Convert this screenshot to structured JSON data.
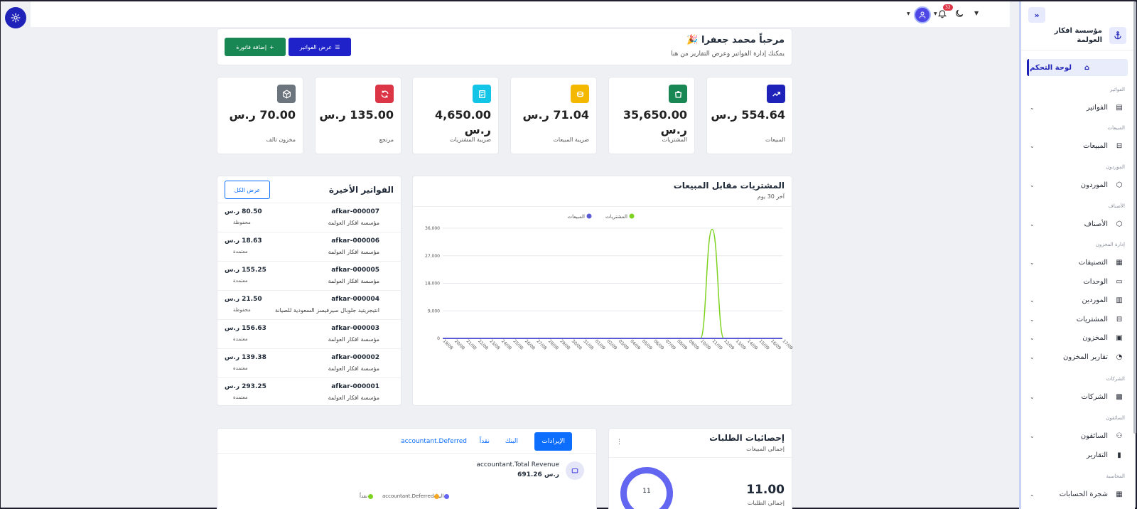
{
  "topbar": {
    "notif_count": "32"
  },
  "sidebar": {
    "org_name": "مؤسسة افكار العولمة",
    "dashboard": "لوحة التحكم",
    "sections": {
      "invoices": "الفواتير",
      "sales": "المبيعات",
      "suppliers": "الموردون",
      "items": "الأصناف",
      "inventory": "إدارة المخزون",
      "companies": "الشركات",
      "drivers": "السائقون",
      "accounting": "المحاسبة"
    },
    "items": {
      "invoices": "الفواتير",
      "sales": "المبيعات",
      "suppliers": "الموردون",
      "items": "الأصناف",
      "categories": "التصنيفات",
      "units": "الوحدات",
      "vendors": "الموردين",
      "purchases": "المشتريات",
      "stock": "المخزون",
      "stock_reports": "تقارير المخزون",
      "companies": "الشركات",
      "drivers": "السائقون",
      "reports": "التقارير",
      "chart_of_accounts": "شجرة الحسابات"
    }
  },
  "welcome": {
    "title": "مرحباً محمد جعفرا",
    "emoji": "🎉",
    "subtitle": "يمكنك إدارة الفواتير وعرض التقارير من هنا",
    "view_invoices": "عرض الفواتير",
    "add_invoice": "إضافة فاتورة"
  },
  "stats": [
    {
      "value": "554.64 ر.س",
      "label": "المبيعات",
      "color": "#1e22b8",
      "icon": "trending-up-icon"
    },
    {
      "value": "35,650.00 ر.س",
      "label": "المشتريات",
      "color": "#198754",
      "icon": "shopping-bag-icon"
    },
    {
      "value": "71.04 ر.س",
      "label": "ضريبة المبيعات",
      "color": "#f5b800",
      "icon": "coins-icon"
    },
    {
      "value": "4,650.00 ر.س",
      "label": "ضريبة المشتريات",
      "color": "#12c4e6",
      "icon": "receipt-icon"
    },
    {
      "value": "135.00 ر.س",
      "label": "مرتجع",
      "color": "#dc3545",
      "icon": "refresh-icon"
    },
    {
      "value": "70.00 ر.س",
      "label": "مخزون تالف",
      "color": "#6c757d",
      "icon": "box-icon"
    }
  ],
  "chart": {
    "title": "المشتريات مقابل المبيعات",
    "subtitle": "آخر 30 يوم",
    "legend_purchases": "المشتريات",
    "legend_sales": "المبيعات"
  },
  "chart_data": {
    "type": "line",
    "x": [
      "19/08",
      "20/08",
      "21/08",
      "22/08",
      "23/08",
      "24/08",
      "25/08",
      "26/08",
      "27/08",
      "28/08",
      "29/08",
      "30/08",
      "31/08",
      "01/09",
      "02/09",
      "03/09",
      "04/09",
      "05/09",
      "06/09",
      "07/09",
      "08/09",
      "09/09",
      "10/09",
      "11/09",
      "12/09",
      "13/09",
      "14/09",
      "15/09",
      "16/09",
      "17/09"
    ],
    "series": [
      {
        "name": "المشتريات",
        "color": "#7ed321",
        "values": [
          0,
          0,
          0,
          0,
          0,
          0,
          0,
          0,
          0,
          0,
          0,
          0,
          0,
          0,
          0,
          0,
          0,
          0,
          0,
          0,
          0,
          0,
          0,
          35650,
          0,
          0,
          0,
          0,
          0,
          0
        ]
      },
      {
        "name": "المبيعات",
        "color": "#5b5bd6",
        "values": [
          0,
          0,
          0,
          0,
          0,
          0,
          0,
          0,
          0,
          0,
          0,
          0,
          0,
          0,
          0,
          0,
          0,
          0,
          0,
          0,
          0,
          0,
          0,
          0,
          0,
          0,
          0,
          0,
          0,
          0
        ]
      }
    ],
    "yticks": [
      "0",
      "9,000",
      "18,000",
      "27,000",
      "36,000"
    ],
    "ylim": [
      0,
      36000
    ],
    "legend": "top-center",
    "grid": true
  },
  "recent": {
    "title": "الفواتير الأخيرة",
    "view_all": "عرض الكل",
    "rows": [
      {
        "number": "afkar-000007",
        "company": "مؤسسة افكار العولمة",
        "amount": "80.50 ر.س",
        "status": "محفوظة"
      },
      {
        "number": "afkar-000006",
        "company": "مؤسسة افكار العولمة",
        "amount": "18.63 ر.س",
        "status": "معتمدة"
      },
      {
        "number": "afkar-000005",
        "company": "مؤسسة افكار العولمة",
        "amount": "155.25 ر.س",
        "status": "معتمدة"
      },
      {
        "number": "afkar-000004",
        "company": "انتيجريتيد جلوبال سيرفيسز السعودية للصيانة",
        "amount": "21.50 ر.س",
        "status": "محفوظة"
      },
      {
        "number": "afkar-000003",
        "company": "مؤسسة افكار العولمة",
        "amount": "156.63 ر.س",
        "status": "معتمدة"
      },
      {
        "number": "afkar-000002",
        "company": "مؤسسة افكار العولمة",
        "amount": "139.38 ر.س",
        "status": "معتمدة"
      },
      {
        "number": "afkar-000001",
        "company": "مؤسسة افكار العولمة",
        "amount": "293.25 ر.س",
        "status": "معتمدة"
      }
    ]
  },
  "orders": {
    "title": "إحصائيات الطلبات",
    "subtitle": "إجمالي المبيعات",
    "total": "11.00",
    "total_label": "إجمالي الطلبات",
    "donut_value": "11"
  },
  "revenue": {
    "tabs": [
      "الإيرادات",
      "البنك",
      "نقداً",
      "accountant.Deferred"
    ],
    "total_label": "accountant.Total Revenue",
    "total_value": "691.26 ر.س",
    "legend": [
      "البنك",
      "accountant.Deferred",
      "نقداً"
    ]
  }
}
